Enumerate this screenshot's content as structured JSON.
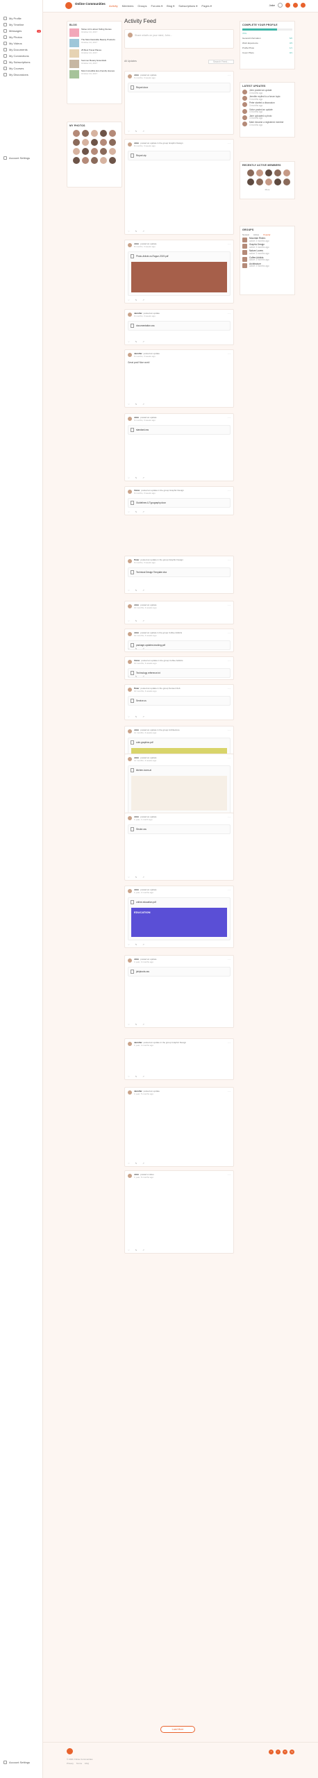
{
  "site": {
    "brand": "Online Communities"
  },
  "menu": [
    "Activity",
    "Members",
    "Groups",
    "Forums ▾",
    "Blog ▾",
    "Subscriptions ▾",
    "Pages ▾"
  ],
  "topbar_user": "Jake",
  "leftnav": [
    {
      "label": "My Profile"
    },
    {
      "label": "My Timeline"
    },
    {
      "label": "Messages",
      "badge": "1"
    },
    {
      "label": "My Photos"
    },
    {
      "label": "My Videos"
    },
    {
      "label": "My Documents"
    },
    {
      "label": "My Connections"
    },
    {
      "label": "My Subscriptions"
    },
    {
      "label": "My Courses"
    },
    {
      "label": "My Discussions"
    }
  ],
  "leftnav_bottom": [
    "Account Settings",
    "Account Settings"
  ],
  "feed": {
    "title": "Activity Feed",
    "post_placeholder": "Share what's on your mind, John...",
    "filter_label": "All Updates",
    "search_placeholder": "Search Feed..."
  },
  "blog": {
    "title": "BLOG",
    "items": [
      {
        "title": "Tattoo Art Is about Telling Stories",
        "date": "October 24, 2017"
      },
      {
        "title": "The Most Desirable Beauty Products",
        "date": "October 24, 2017"
      },
      {
        "title": "25 Best Travel Places",
        "date": "October 24, 2017"
      },
      {
        "title": "Summer Beauty Essentials",
        "date": "October 24, 2017"
      },
      {
        "title": "Most Incredible Eco-friendly Houses",
        "date": "October 24, 2017"
      }
    ]
  },
  "photo_widget": {
    "title": "MY PHOTOS"
  },
  "profile_complete": {
    "title": "COMPLETE YOUR PROFILE",
    "percent": "70%",
    "items": [
      {
        "label": "General Information",
        "value": "6/6"
      },
      {
        "label": "Work Experience",
        "value": "3/3"
      },
      {
        "label": "Profile Photo",
        "value": "1/1"
      },
      {
        "label": "Cover Photo",
        "value": "0/1"
      }
    ]
  },
  "latest_updates": {
    "title": "LATEST UPDATES",
    "items": [
      {
        "text": "John posted an update",
        "time": "3 months ago"
      },
      {
        "text": "Jennifer replied to a forum topic",
        "time": "3 months ago"
      },
      {
        "text": "Peter started a discussion",
        "time": "3 months ago"
      },
      {
        "text": "Victor posted an update",
        "time": "4 months ago"
      },
      {
        "text": "Jane uploaded a photo",
        "time": "4 months ago"
      },
      {
        "text": "Mark became a registered member",
        "time": "4 months ago"
      }
    ]
  },
  "recently_active": {
    "title": "RECENTLY ACTIVE MEMBERS"
  },
  "members_widget": {
    "title": "RECENTLY ACTIVE MEMBERS",
    "more": "More"
  },
  "groups": {
    "title": "GROUPS",
    "tabs": [
      "Newest",
      "Active",
      "Popular"
    ],
    "items": [
      {
        "name": "Mountain Riders",
        "meta": "active 3 months ago"
      },
      {
        "name": "Graphic Design",
        "meta": "active 3 months ago"
      },
      {
        "name": "Nature Lovers",
        "meta": "active 3 months ago"
      },
      {
        "name": "Coffee Addicts",
        "meta": "active 3 months ago"
      },
      {
        "name": "Architecture",
        "meta": "active 3 months ago"
      }
    ]
  },
  "posts": [
    {
      "author": "John",
      "action": "posted an update",
      "time": "6 months, 3 weeks ago",
      "attachment": "Report.docx",
      "comments": "3 Comments",
      "likes": "You and 2 others like this",
      "actions": [
        "Like",
        "Comment",
        "Share"
      ]
    },
    {
      "author": "John",
      "action": "posted an update in the group Graphic Design",
      "time": "8 months, 3 weeks ago",
      "attachment": "Report.zip"
    },
    {
      "author": "John",
      "action": "posted an update",
      "time": "8 months, 3 weeks ago",
      "attachment": "Photo-Article-vs-Rogue-2019.pdf"
    },
    {
      "author": "Jennifer",
      "action": "posted an update",
      "time": "9 months, 3 weeks ago",
      "attachment": "documentation.css"
    },
    {
      "author": "Jennifer",
      "action": "posted an update",
      "time": "9 months, 3 weeks ago",
      "text": "Great post! Nice work!"
    },
    {
      "author": "John",
      "action": "posted an update",
      "time": "9 months, 3 weeks ago",
      "attachment": "standard.css"
    },
    {
      "author": "Victor",
      "action": "posted an update in the group Graphic Design",
      "time": "9 months, 3 weeks ago",
      "attachment": "Guidelines & Typography.docx"
    },
    {
      "author": "Peter",
      "action": "posted an update in the group Graphic Design",
      "time": "9 months, 3 weeks ago",
      "attachment": "Technical Design Template.xlsx"
    },
    {
      "author": "John",
      "action": "posted an update",
      "time": "10 months, 3 weeks ago"
    },
    {
      "author": "John",
      "action": "posted an update in the group Coffee Addicts",
      "time": "10 months, 3 weeks ago",
      "attachment": "package-updates-tracking.pdf"
    },
    {
      "author": "Victor",
      "action": "posted an update in the group Coffee Addicts",
      "time": "10 months, 3 weeks ago",
      "attachment": "Technology reference.txt"
    },
    {
      "author": "Peter",
      "action": "posted an update in the group Sunset Club",
      "time": "10 months, 3 weeks ago",
      "attachment": "Service.cs"
    },
    {
      "author": "John",
      "action": "posted an update in the group Architecture",
      "time": "11 months, 3 weeks ago",
      "attachment": "cute-graphics.pdf"
    },
    {
      "author": "John",
      "action": "posted an update",
      "time": "11 months, 3 weeks ago",
      "attachment": "kitchen-icons.ai"
    },
    {
      "author": "John",
      "action": "posted an update",
      "time": "1 year, 1 month ago",
      "attachment": "Stroke.css"
    },
    {
      "author": "John",
      "action": "posted an update",
      "time": "1 year, 2 months ago",
      "attachment": "online-education.pdf",
      "caption": "EDUCATION"
    },
    {
      "author": "John",
      "action": "posted an update",
      "time": "1 year, 3 months ago",
      "attachment": "jshiptools.css"
    },
    {
      "author": "Jennifer",
      "action": "posted an update in the group Graphic Design",
      "time": "1 year, 4 months ago"
    },
    {
      "author": "Jennifer",
      "action": "posted an update",
      "time": "1 year, 5 months ago"
    },
    {
      "author": "John",
      "action": "posted a video",
      "time": "1 year, 6 months ago"
    }
  ],
  "load_more": "Load More",
  "footer": {
    "copyright": "© 2021 Online Communities",
    "links": [
      "Privacy",
      "Terms",
      "FAQ"
    ],
    "social": [
      "f",
      "t",
      "in",
      "ig"
    ]
  }
}
